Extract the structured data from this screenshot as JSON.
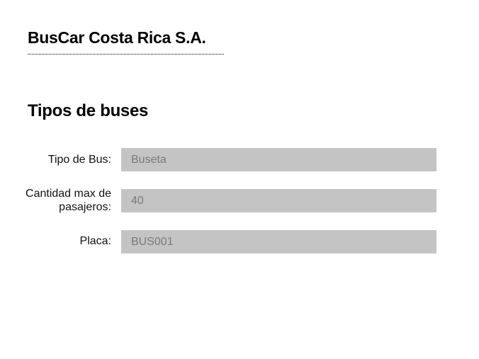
{
  "header": {
    "company_name": "BusCar Costa Rica S.A."
  },
  "section": {
    "title": "Tipos de buses"
  },
  "form": {
    "tipo_bus": {
      "label": "Tipo de Bus:",
      "value": "Buseta"
    },
    "cantidad_max": {
      "label_line1": "Cantidad max de",
      "label_line2": "pasajeros:",
      "value": "40"
    },
    "placa": {
      "label": "Placa:",
      "value": "BUS001"
    }
  },
  "colors": {
    "input_background": "#c4c4c4",
    "input_text": "#7a7a7a",
    "text": "#000000"
  }
}
